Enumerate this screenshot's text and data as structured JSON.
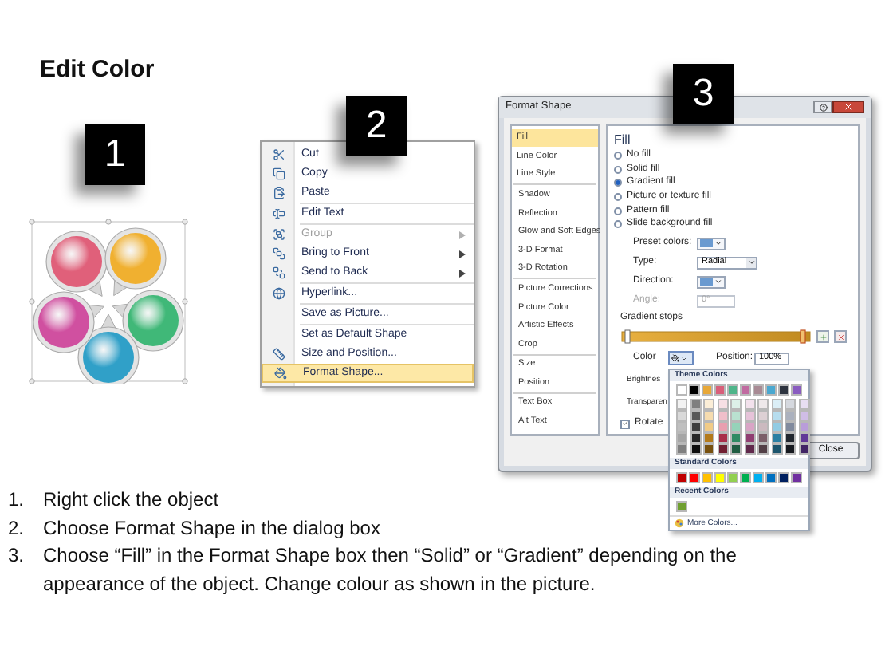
{
  "slide": {
    "title": "Edit Color"
  },
  "badges": [
    "1",
    "2",
    "3"
  ],
  "context_menu": {
    "groups": [
      [
        {
          "label": "Cut",
          "disabled": false,
          "submenu": false,
          "selected": false
        },
        {
          "label": "Copy",
          "disabled": false,
          "submenu": false,
          "selected": false
        },
        {
          "label": "Paste",
          "disabled": false,
          "submenu": false,
          "selected": false
        }
      ],
      [
        {
          "label": "Edit Text",
          "disabled": false,
          "submenu": false,
          "selected": false
        }
      ],
      [
        {
          "label": "Group",
          "disabled": true,
          "submenu": true,
          "selected": false
        },
        {
          "label": "Bring to Front",
          "disabled": false,
          "submenu": true,
          "selected": false
        },
        {
          "label": "Send to Back",
          "disabled": false,
          "submenu": true,
          "selected": false
        }
      ],
      [
        {
          "label": "Hyperlink...",
          "disabled": false,
          "submenu": false,
          "selected": false
        }
      ],
      [
        {
          "label": "Save as Picture...",
          "disabled": false,
          "submenu": false,
          "selected": false
        }
      ],
      [
        {
          "label": "Set as Default Shape",
          "disabled": false,
          "submenu": false,
          "selected": false
        },
        {
          "label": "Size and Position...",
          "disabled": false,
          "submenu": false,
          "selected": false
        },
        {
          "label": "Format Shape...",
          "disabled": false,
          "submenu": false,
          "selected": true
        }
      ]
    ]
  },
  "dialog": {
    "title": "Format Shape",
    "nav_groups": [
      [
        {
          "label": "Fill",
          "selected": true
        },
        {
          "label": "Line Color",
          "selected": false
        },
        {
          "label": "Line Style",
          "selected": false
        }
      ],
      [
        {
          "label": "Shadow",
          "selected": false
        },
        {
          "label": "Reflection",
          "selected": false
        },
        {
          "label": "Glow and Soft Edges",
          "selected": false
        },
        {
          "label": "3-D Format",
          "selected": false
        },
        {
          "label": "3-D Rotation",
          "selected": false
        }
      ],
      [
        {
          "label": "Picture Corrections",
          "selected": false
        },
        {
          "label": "Picture Color",
          "selected": false
        },
        {
          "label": "Artistic Effects",
          "selected": false
        },
        {
          "label": "Crop",
          "selected": false
        }
      ],
      [
        {
          "label": "Size",
          "selected": false
        },
        {
          "label": "Position",
          "selected": false
        }
      ],
      [
        {
          "label": "Text Box",
          "selected": false
        },
        {
          "label": "Alt Text",
          "selected": false
        }
      ]
    ],
    "heading": "Fill",
    "fill_options": [
      {
        "label": "No fill",
        "selected": false
      },
      {
        "label": "Solid fill",
        "selected": false
      },
      {
        "label": "Gradient fill",
        "selected": true
      },
      {
        "label": "Picture or texture fill",
        "selected": false
      },
      {
        "label": "Pattern fill",
        "selected": false
      },
      {
        "label": "Slide background fill",
        "selected": false
      }
    ],
    "preset_colors_label": "Preset colors:",
    "type_label": "Type:",
    "type_value": "Radial",
    "direction_label": "Direction:",
    "angle": {
      "label": "Angle:",
      "value": "0°",
      "disabled": true
    },
    "gradient_stops_label": "Gradient stops",
    "color_label": "Color",
    "position_label": "Position:",
    "position_value": "100%",
    "brightness_label": "Brightnes",
    "transparency_label": "Transparen",
    "rotate": {
      "label": "Rotate",
      "checked": true
    },
    "close_button": "Close",
    "color_popup": {
      "theme_title": "Theme Colors",
      "theme_colors": [
        {
          "color": "#ffffff",
          "shades": [
            {
              "color": "#f2f2f2"
            },
            {
              "color": "#d9d9d9"
            },
            {
              "color": "#bfbfbf"
            },
            {
              "color": "#a6a6a6"
            },
            {
              "color": "#808080"
            }
          ]
        },
        {
          "color": "#000000",
          "shades": [
            {
              "color": "#7f7f7f"
            },
            {
              "color": "#595959"
            },
            {
              "color": "#3f3f3f"
            },
            {
              "color": "#262626"
            },
            {
              "color": "#0d0d0d"
            }
          ]
        },
        {
          "color": "#e8a838",
          "shades": [
            {
              "color": "#fbeed7"
            },
            {
              "color": "#f6dcaf"
            },
            {
              "color": "#f1cb87"
            },
            {
              "color": "#b47a1a"
            },
            {
              "color": "#78510f"
            }
          ]
        },
        {
          "color": "#d95f7a",
          "shades": [
            {
              "color": "#f7dfe4"
            },
            {
              "color": "#f0bfca"
            },
            {
              "color": "#e89faf"
            },
            {
              "color": "#a92f4a"
            },
            {
              "color": "#711f31"
            }
          ]
        },
        {
          "color": "#4fb58a",
          "shades": [
            {
              "color": "#dcf0e8"
            },
            {
              "color": "#b9e1d0"
            },
            {
              "color": "#95d3b9"
            },
            {
              "color": "#2f8a63"
            },
            {
              "color": "#1f5c42"
            }
          ]
        },
        {
          "color": "#c06aa0",
          "shades": [
            {
              "color": "#f2e1ec"
            },
            {
              "color": "#e6c3d9"
            },
            {
              "color": "#d9a5c6"
            },
            {
              "color": "#903e72"
            },
            {
              "color": "#60294c"
            }
          ]
        },
        {
          "color": "#a88a94",
          "shades": [
            {
              "color": "#eee8ea"
            },
            {
              "color": "#ddd0d4"
            },
            {
              "color": "#cbb9bf"
            },
            {
              "color": "#7b5f69"
            },
            {
              "color": "#523f46"
            }
          ]
        },
        {
          "color": "#4aa8d0",
          "shades": [
            {
              "color": "#dbeef6"
            },
            {
              "color": "#b7ddee"
            },
            {
              "color": "#92cbe3"
            },
            {
              "color": "#2a7fa3"
            },
            {
              "color": "#1c556d"
            }
          ]
        },
        {
          "color": "#2e3440",
          "shades": [
            {
              "color": "#d5d8de"
            },
            {
              "color": "#abb1be"
            },
            {
              "color": "#818a9d"
            },
            {
              "color": "#22272f"
            },
            {
              "color": "#171a20"
            }
          ]
        },
        {
          "color": "#8a5cc0",
          "shades": [
            {
              "color": "#e8def2"
            },
            {
              "color": "#d0bde6"
            },
            {
              "color": "#b99dd9"
            },
            {
              "color": "#613897"
            },
            {
              "color": "#412565"
            }
          ]
        }
      ],
      "standard_title": "Standard Colors",
      "standard_colors": [
        {
          "color": "#c00000"
        },
        {
          "color": "#ff0000"
        },
        {
          "color": "#ffc000"
        },
        {
          "color": "#ffff00"
        },
        {
          "color": "#92d050"
        },
        {
          "color": "#00b050"
        },
        {
          "color": "#00b0f0"
        },
        {
          "color": "#0070c0"
        },
        {
          "color": "#002060"
        },
        {
          "color": "#7030a0"
        }
      ],
      "recent_title": "Recent Colors",
      "recent_colors": [
        {
          "color": "#70a030"
        }
      ],
      "more_colors": "More Colors..."
    }
  },
  "steps": [
    {
      "number": "1.",
      "text": "Right click the object"
    },
    {
      "number": "2.",
      "text": "Choose Format Shape in the dialog box"
    },
    {
      "number": "3.",
      "text": "Choose “Fill” in the Format Shape box then “Solid” or “Gradient” depending on the appearance of the object. Change colour as shown in the picture."
    }
  ]
}
